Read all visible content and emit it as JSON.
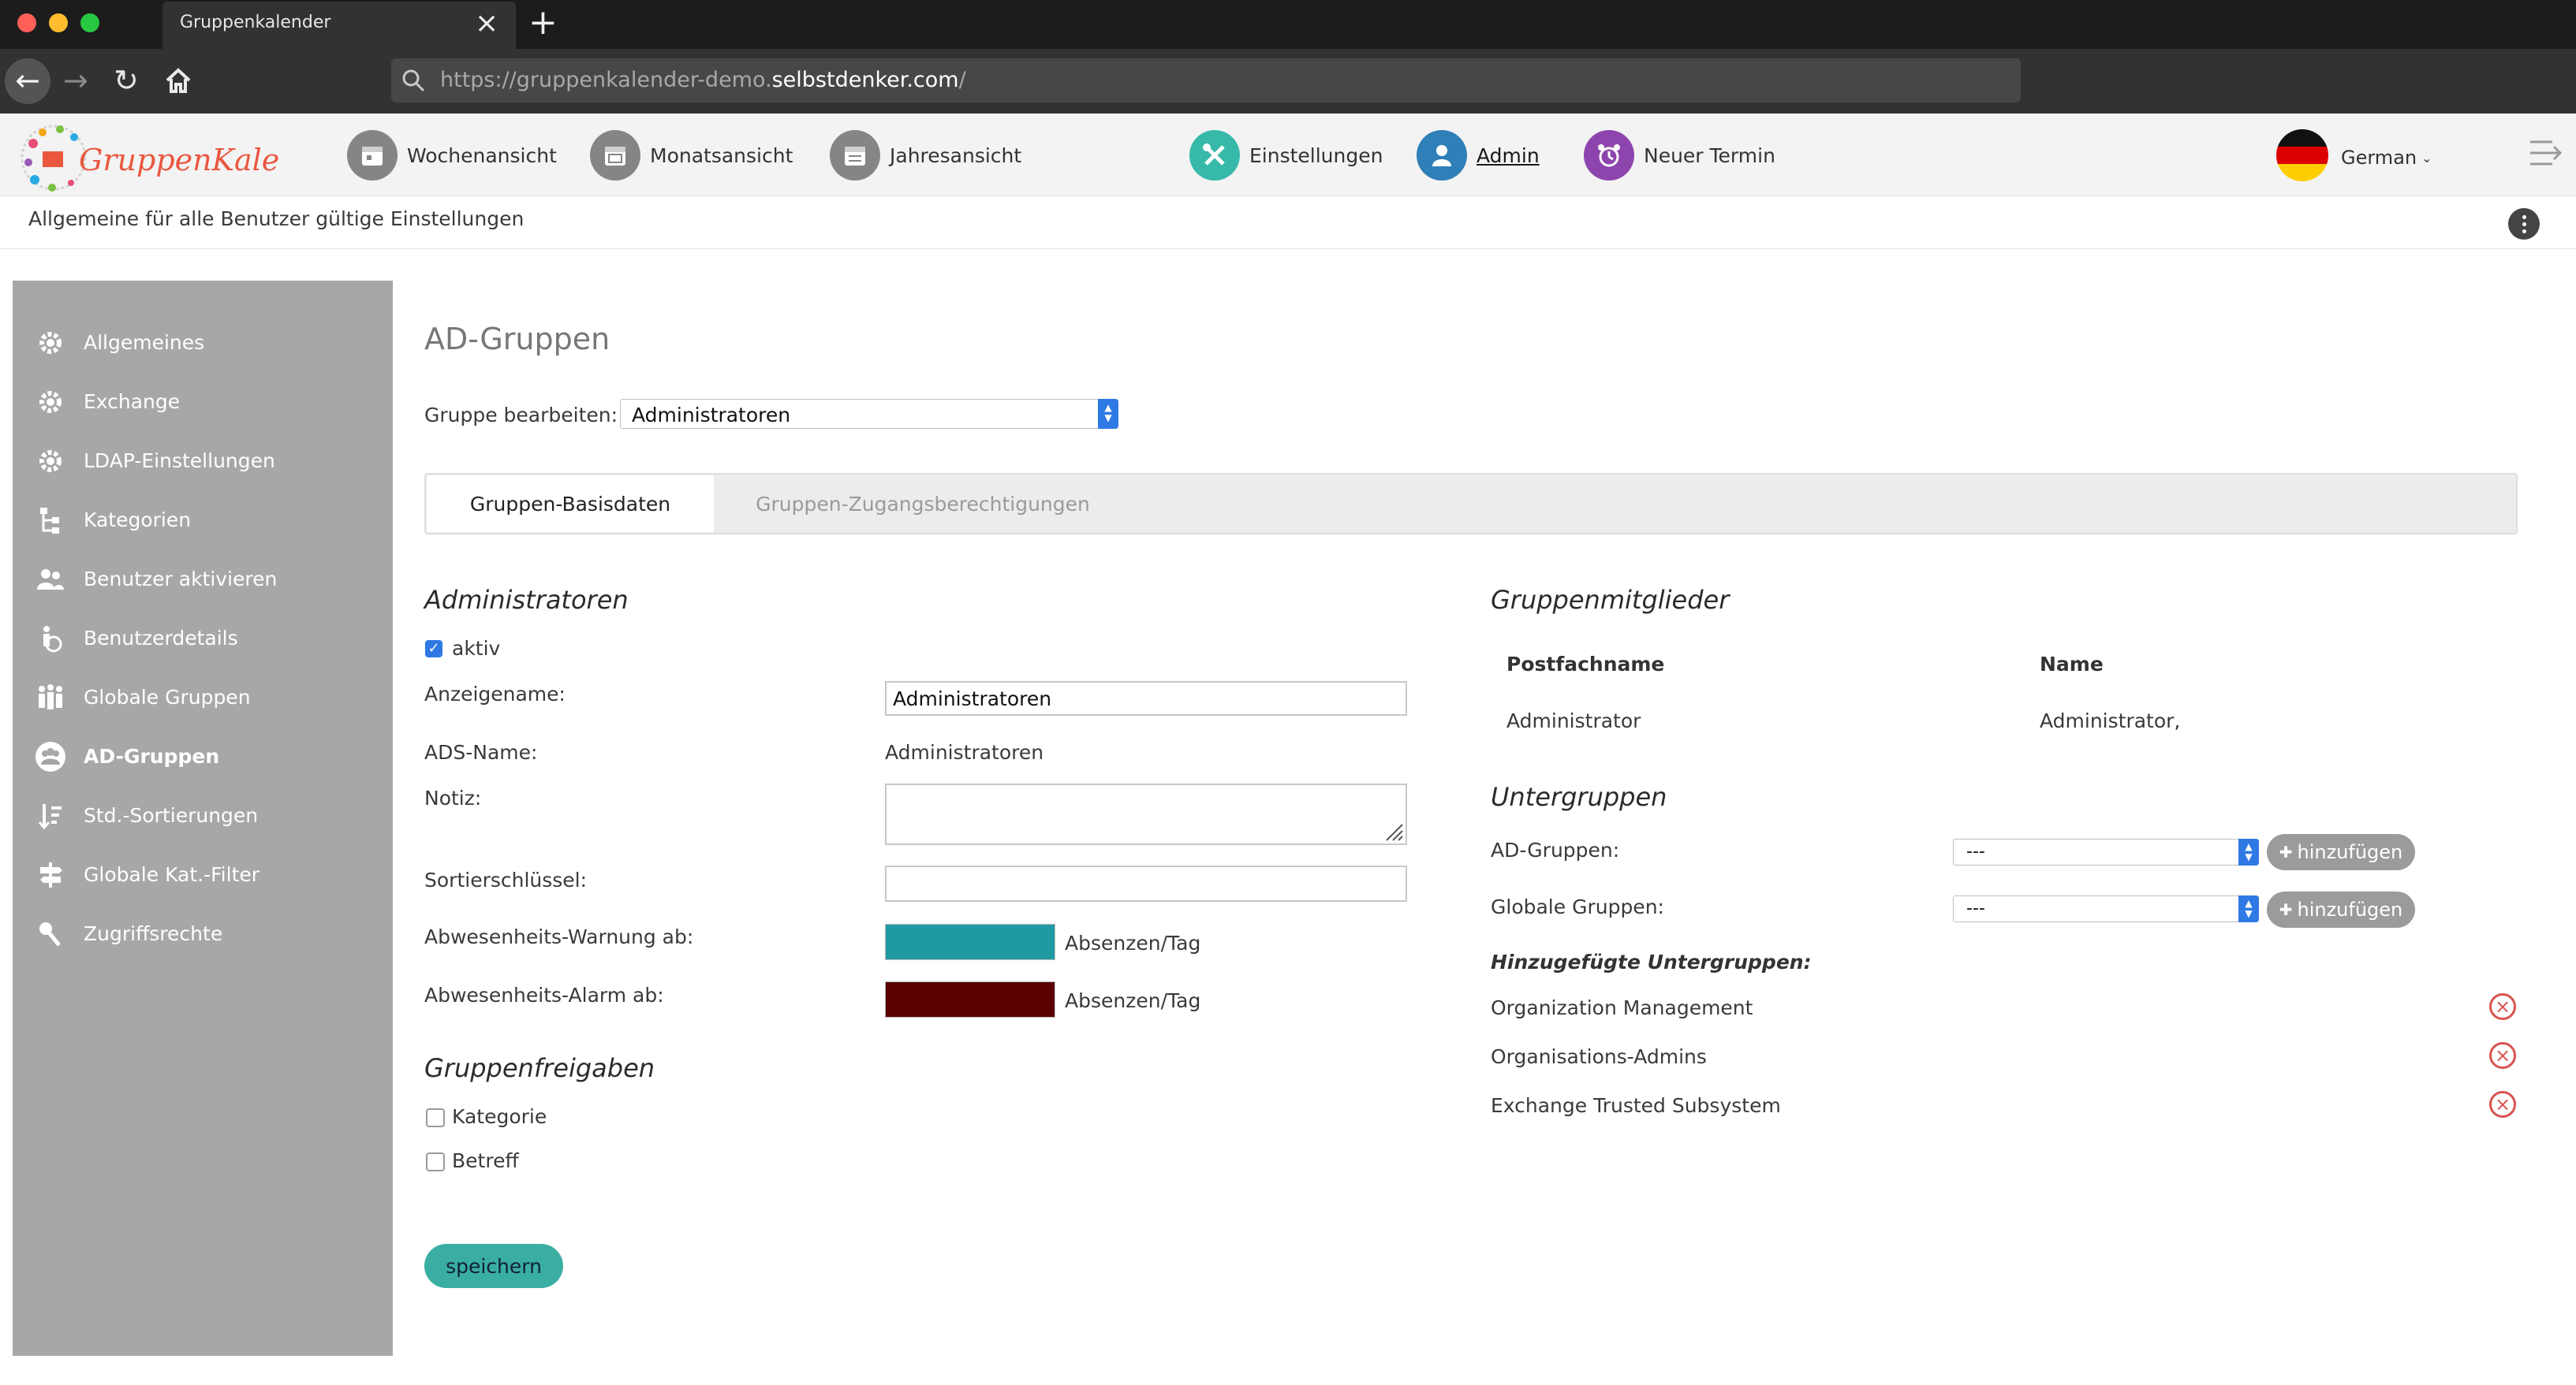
{
  "browser": {
    "tab_title": "Gruppenkalender",
    "url_prefix": "https://gruppenkalender-demo.",
    "url_domain": "selbstdenker.com",
    "url_suffix": "/"
  },
  "app": {
    "logo_text": "GruppenKalender",
    "nav": {
      "week": "Wochenansicht",
      "month": "Monatsansicht",
      "year": "Jahresansicht",
      "settings": "Einstellungen",
      "admin": "Admin",
      "new_appointment": "Neuer Termin"
    },
    "language": "German",
    "subheader": "Allgemeine für alle Benutzer gültige Einstellungen"
  },
  "sidebar": {
    "items": [
      {
        "label": "Allgemeines"
      },
      {
        "label": "Exchange"
      },
      {
        "label": "LDAP-Einstellungen"
      },
      {
        "label": "Kategorien"
      },
      {
        "label": "Benutzer aktivieren"
      },
      {
        "label": "Benutzerdetails"
      },
      {
        "label": "Globale Gruppen"
      },
      {
        "label": "AD-Gruppen"
      },
      {
        "label": "Std.-Sortierungen"
      },
      {
        "label": "Globale Kat.-Filter"
      },
      {
        "label": "Zugriffsrechte"
      }
    ]
  },
  "main": {
    "title": "AD-Gruppen",
    "edit_group_label": "Gruppe bearbeiten:",
    "edit_group_value": "Administratoren",
    "tabs": [
      {
        "label": "Gruppen-Basisdaten"
      },
      {
        "label": "Gruppen-Zugangsberechtigungen"
      }
    ],
    "group": {
      "heading": "Administratoren",
      "active_label": "aktiv",
      "display_name_label": "Anzeigename:",
      "display_name_value": "Administratoren",
      "ads_name_label": "ADS-Name:",
      "ads_name_value": "Administratoren",
      "note_label": "Notiz:",
      "note_value": "",
      "sort_key_label": "Sortierschlüssel:",
      "sort_key_value": "",
      "warning_label": "Abwesenheits-Warnung ab:",
      "warning_color": "#1f9aa3",
      "warning_unit": "Absenzen/Tag",
      "alarm_label": "Abwesenheits-Alarm ab:",
      "alarm_color": "#5a0202",
      "alarm_unit": "Absenzen/Tag"
    },
    "shares": {
      "heading": "Gruppenfreigaben",
      "category_label": "Kategorie",
      "subject_label": "Betreff"
    },
    "save_label": "speichern",
    "members": {
      "heading": "Gruppenmitglieder",
      "columns": [
        "Postfachname",
        "Name"
      ],
      "rows": [
        [
          "Administrator",
          "Administrator,"
        ]
      ]
    },
    "subgroups": {
      "heading": "Untergruppen",
      "ad_label": "AD-Gruppen:",
      "ad_value": "---",
      "global_label": "Globale Gruppen:",
      "global_value": "---",
      "add_label": "hinzufügen",
      "added_heading": "Hinzugefügte Untergruppen:",
      "added": [
        "Organization Management",
        "Organisations-Admins",
        "Exchange Trusted Subsystem"
      ]
    }
  }
}
